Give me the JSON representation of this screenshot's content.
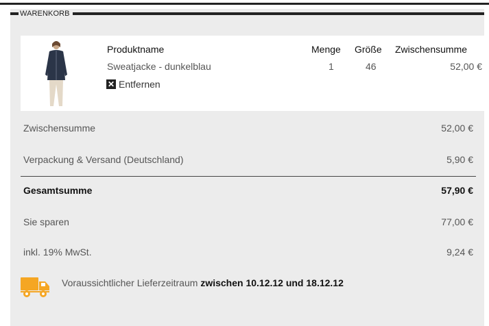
{
  "cart": {
    "section_title": "WARENKORB",
    "headers": {
      "product": "Produktname",
      "qty": "Menge",
      "size": "Größe",
      "subtotal": "Zwischensumme"
    },
    "item": {
      "name": "Sweatjacke - dunkelblau",
      "qty": "1",
      "size": "46",
      "subtotal": "52,00 €",
      "remove_label": "Entfernen",
      "remove_icon": "close-icon"
    },
    "totals": {
      "subtotal_label": "Zwischensumme",
      "subtotal_value": "52,00 €",
      "shipping_label": "Verpackung & Versand (Deutschland)",
      "shipping_value": "5,90 €",
      "total_label": "Gesamtsumme",
      "total_value": "57,90 €",
      "savings_label": "Sie sparen",
      "savings_value": "77,00 €",
      "vat_label": "inkl. 19% MwSt.",
      "vat_value": "9,24 €"
    },
    "delivery": {
      "icon": "truck-icon",
      "prefix": "Voraussichtlicher Lieferzeitraum",
      "range": "zwischen 10.12.12 und 18.12.12"
    }
  },
  "colors": {
    "accent": "#f5a623",
    "panel_bg": "#ececec",
    "dark": "#222222"
  }
}
